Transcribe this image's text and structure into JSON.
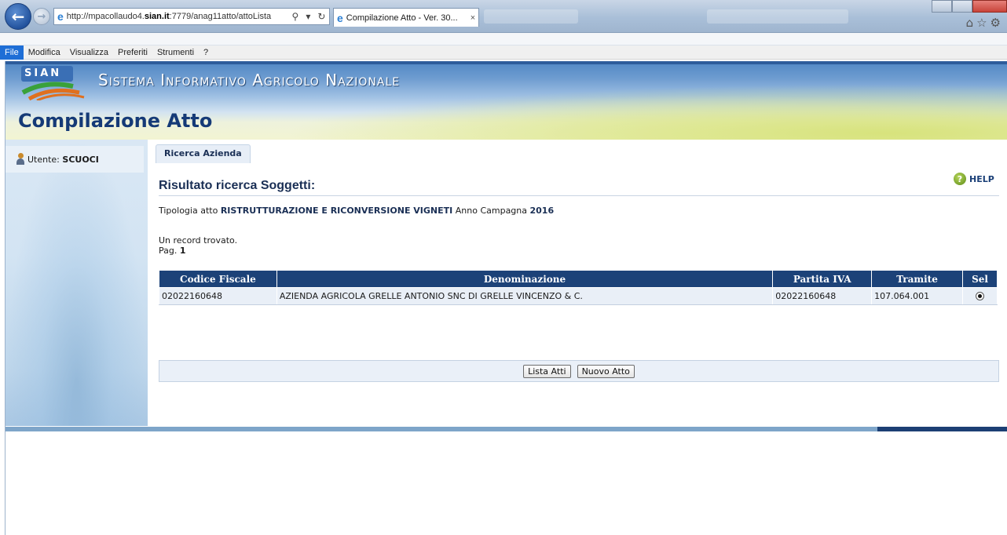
{
  "browser": {
    "url_prefix": "http://mpacollaudo4.",
    "url_host": "sian.it",
    "url_suffix": ":7779/anag11atto/attoLista",
    "search_glyph": "⚲",
    "tab_title": "Compilazione Atto - Ver. 30...",
    "tab_close": "×",
    "menu": [
      "File",
      "Modifica",
      "Visualizza",
      "Preferiti",
      "Strumenti",
      "?"
    ]
  },
  "banner": {
    "logo_text": "SIAN",
    "system_name": "Sistema Informativo Agricolo Nazionale",
    "page_title": "Compilazione Atto"
  },
  "sidebar": {
    "user_prefix": "Utente:",
    "user_name": "SCUOCI"
  },
  "main": {
    "breadcrumb": "Ricerca Azienda",
    "help_label": "HELP",
    "results_title": "Risultato ricerca Soggetti:",
    "typology_prefix": "Tipologia atto",
    "typology_value": "RISTRUTTURAZIONE E RICONVERSIONE VIGNETI",
    "campaign_prefix": "Anno Campagna",
    "campaign_value": "2016",
    "records_text": "Un record trovato.",
    "page_prefix": "Pag.",
    "page_value": "1",
    "table": {
      "headers": [
        "Codice Fiscale",
        "Denominazione",
        "Partita IVA",
        "Tramite",
        "Sel"
      ],
      "rows": [
        {
          "codice_fiscale": "02022160648",
          "denominazione": "AZIENDA AGRICOLA GRELLE ANTONIO SNC DI GRELLE VINCENZO & C.",
          "partita_iva": "02022160648",
          "tramite": "107.064.001",
          "selected": true
        }
      ]
    },
    "buttons": {
      "list": "Lista Atti",
      "new": "Nuovo Atto"
    }
  },
  "colors": {
    "header_blue": "#1c4278",
    "title_blue": "#153a77",
    "row_bg": "#e9eff7"
  }
}
